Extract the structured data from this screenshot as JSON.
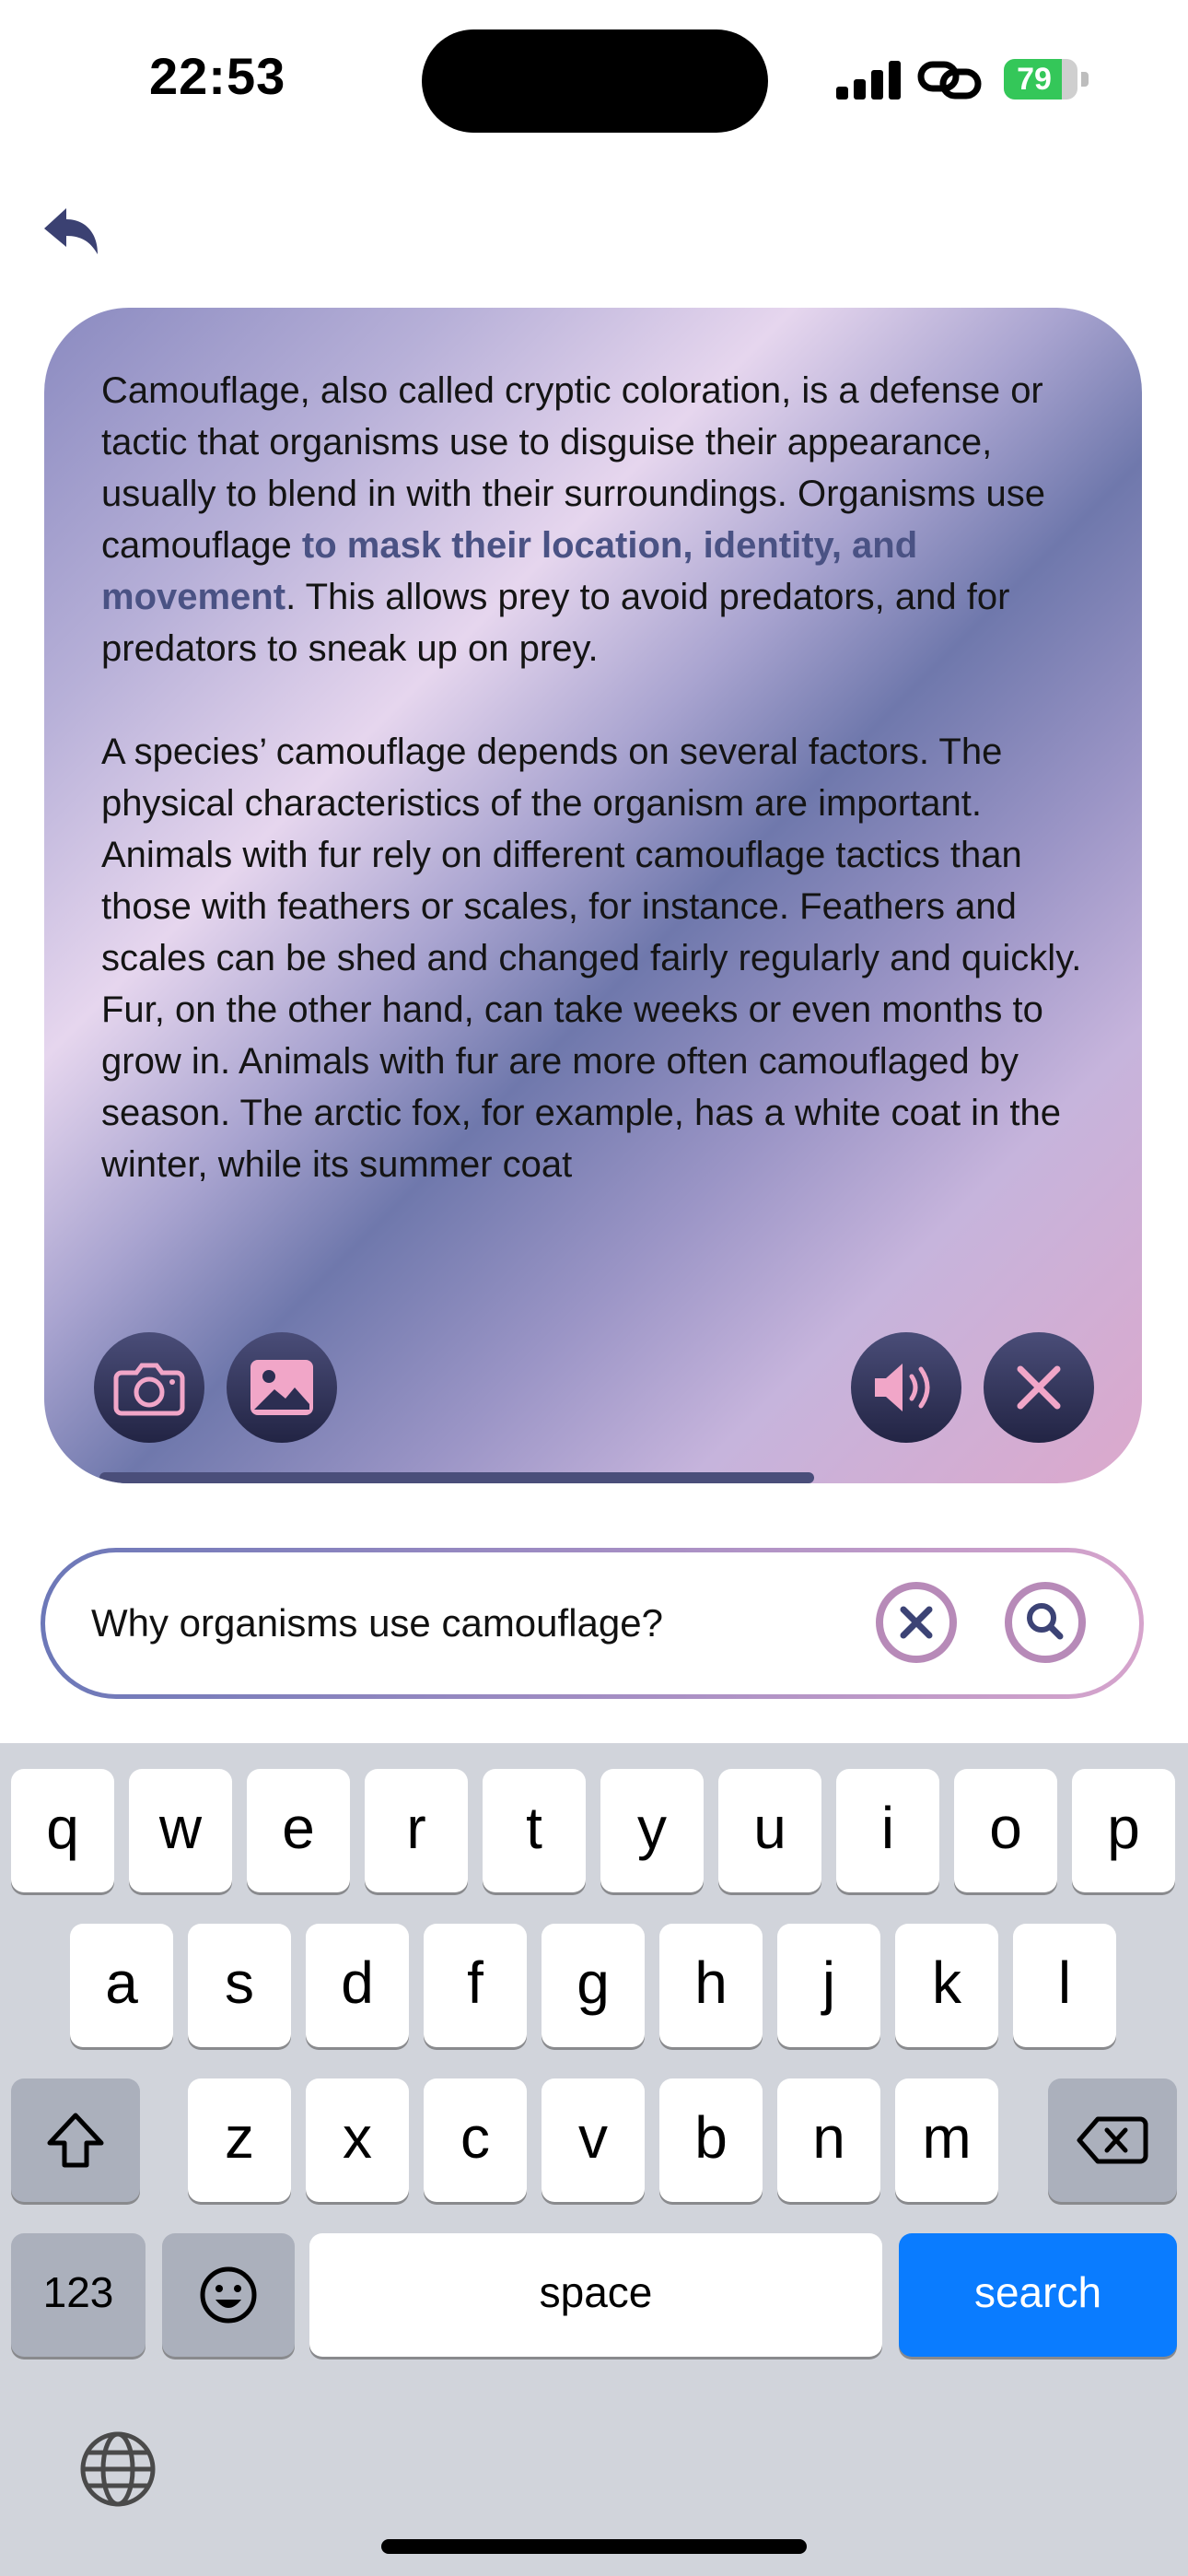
{
  "status": {
    "time": "22:53",
    "battery": "79",
    "battery_level_percent": 79,
    "battery_color": "#34c759"
  },
  "nav": {
    "back_icon": "back-arrow-icon"
  },
  "answer": {
    "paragraph1_before": "Camouflage, also called cryptic coloration, is a defense or tactic that organisms use to disguise their appearance, usually to blend in with their surroundings. Organisms use camouflage ",
    "paragraph1_highlight": "to mask their location, identity, and movement",
    "paragraph1_after": ". This allows prey to avoid predators, and for predators to sneak up on prey.",
    "paragraph2": "A species’ camouflage depends on several factors. The physical characteristics of the organism are important. Animals with fur rely on different camouflage tactics than those with feathers or scales, for instance. Feathers and scales can be shed and changed fairly regularly and quickly. Fur, on the other hand, can take weeks or even months to grow in. Animals with fur are more often camouflaged by season. The arctic fox, for example, has a white coat in the winter, while its summer coat",
    "highlight_color": "#4a5284",
    "actions": [
      "camera-icon",
      "photo-icon",
      "speaker-icon",
      "close-icon"
    ]
  },
  "query": {
    "text": "Why organisms use camouflage?",
    "clear_icon": "clear-icon",
    "search_icon": "search-icon",
    "accent_color": "#b78ab8"
  },
  "keyboard": {
    "row1": [
      "q",
      "w",
      "e",
      "r",
      "t",
      "y",
      "u",
      "i",
      "o",
      "p"
    ],
    "row2": [
      "a",
      "s",
      "d",
      "f",
      "g",
      "h",
      "j",
      "k",
      "l"
    ],
    "row3": [
      "z",
      "x",
      "c",
      "v",
      "b",
      "n",
      "m"
    ],
    "numbers_label": "123",
    "space_label": "space",
    "search_label": "search",
    "search_color": "#0a7cff",
    "icons": [
      "shift-icon",
      "backspace-icon",
      "emoji-icon",
      "globe-icon"
    ]
  }
}
